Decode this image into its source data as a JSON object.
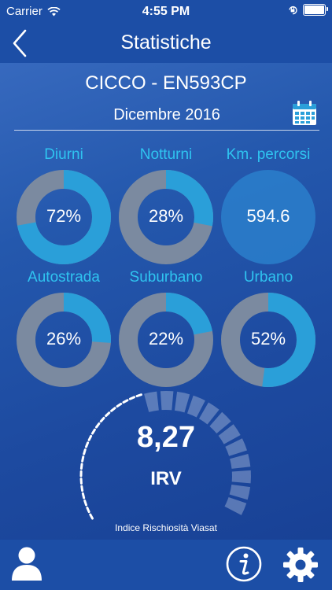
{
  "status_bar": {
    "carrier": "Carrier",
    "time": "4:55 PM"
  },
  "header": {
    "title": "Statistiche",
    "back_icon": "chevron-left-icon"
  },
  "vehicle": "CICCO - EN593CP",
  "period": {
    "month": "Dicembre 2016",
    "icon": "calendar-icon"
  },
  "colors": {
    "accent": "#2fc4f0",
    "ring_fill": "#2a9fd9",
    "ring_track": "#7b8aa0",
    "header": "#1c4ea6"
  },
  "stats": [
    {
      "label": "Diurni",
      "value": "72%",
      "fraction": 0.72
    },
    {
      "label": "Notturni",
      "value": "28%",
      "fraction": 0.28
    },
    {
      "label": "Km. percorsi",
      "value": "594.6"
    },
    {
      "label": "Autostrada",
      "value": "26%",
      "fraction": 0.26
    },
    {
      "label": "Suburbano",
      "value": "22%",
      "fraction": 0.22
    },
    {
      "label": "Urbano",
      "value": "52%",
      "fraction": 0.52
    }
  ],
  "gauge": {
    "score": "8,27",
    "code": "IRV",
    "caption": "Indice Rischiosità Viasat",
    "level": 0.27
  },
  "tab_bar": {
    "icons": [
      "user-icon",
      "info-icon",
      "gear-icon"
    ]
  }
}
